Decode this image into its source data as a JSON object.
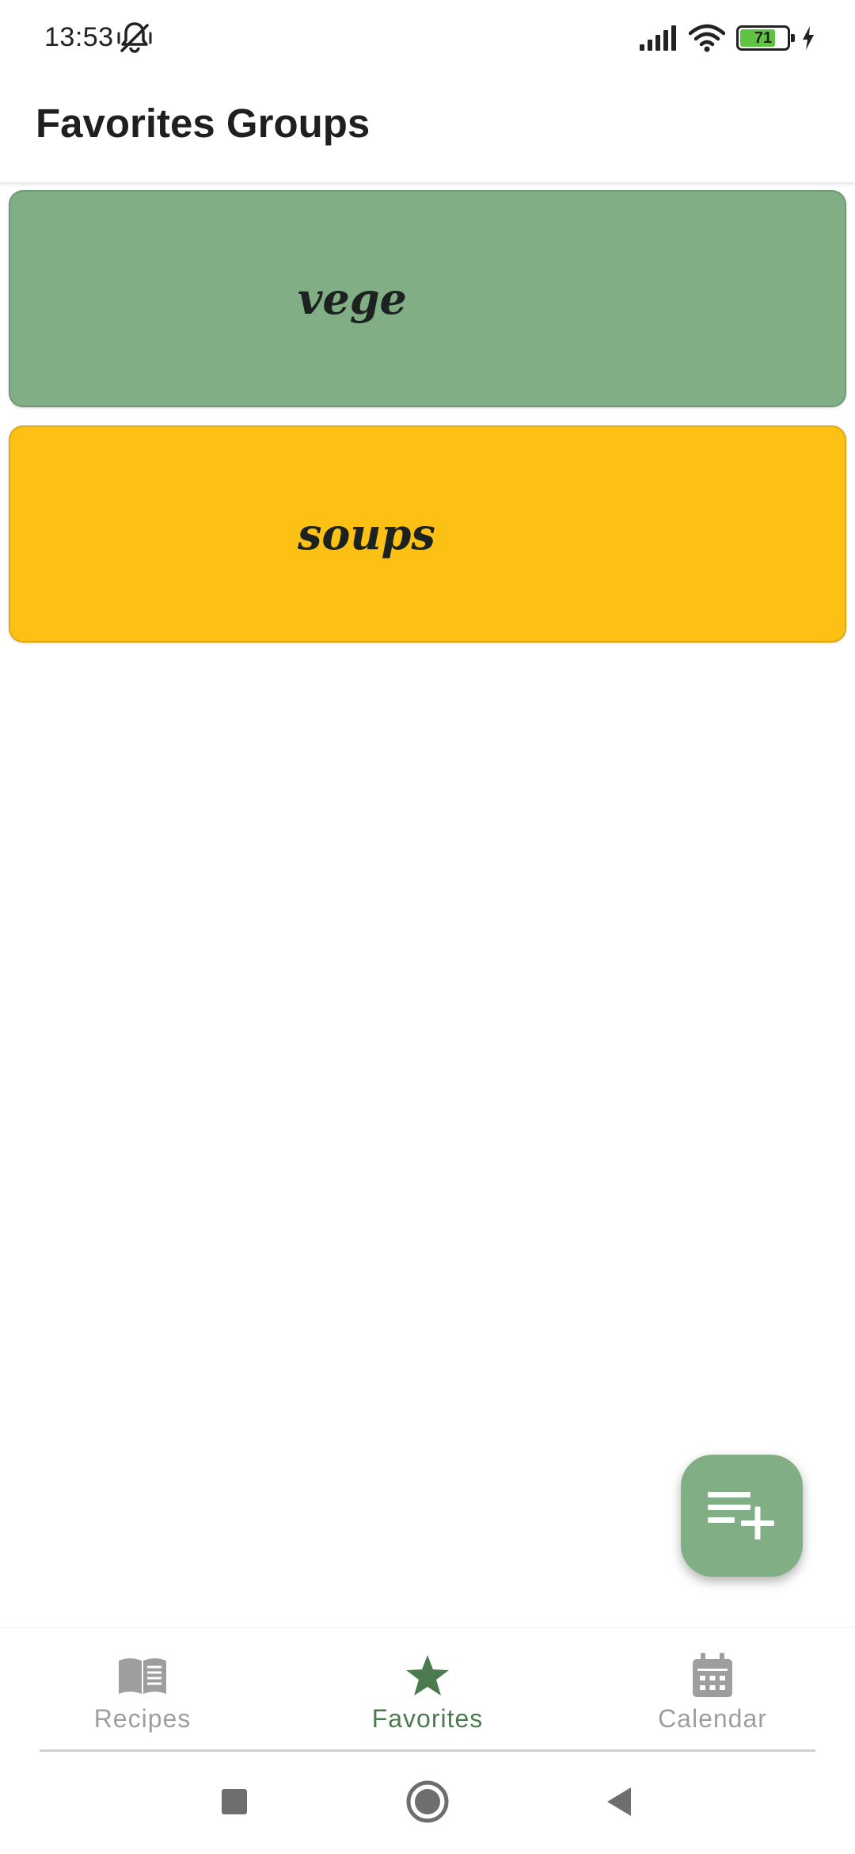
{
  "status_bar": {
    "time": "13:53",
    "left_icons": [
      "silent-bell-icon"
    ],
    "right_icons": [
      "signal-icon",
      "wifi-icon",
      "battery-icon",
      "charging-icon"
    ],
    "battery_level": "71",
    "battery_fraction": 0.71
  },
  "app_bar": {
    "title": "Favorites Groups"
  },
  "groups": [
    {
      "name": "vege",
      "color": "#81AE84"
    },
    {
      "name": "soups",
      "color": "#FDC115"
    }
  ],
  "fab": {
    "icon": "playlist-add-icon",
    "color": "#81AE84"
  },
  "bottom_nav": {
    "items": [
      {
        "label": "Recipes",
        "icon": "open-book-icon",
        "active": false
      },
      {
        "label": "Favorites",
        "icon": "star-icon",
        "active": true
      },
      {
        "label": "Calendar",
        "icon": "calendar-icon",
        "active": false
      }
    ],
    "active_color": "#4A7A4E",
    "inactive_color": "#9E9E9E"
  },
  "system_nav": {
    "buttons": [
      "recents-square-icon",
      "home-circle-icon",
      "back-triangle-icon"
    ]
  }
}
